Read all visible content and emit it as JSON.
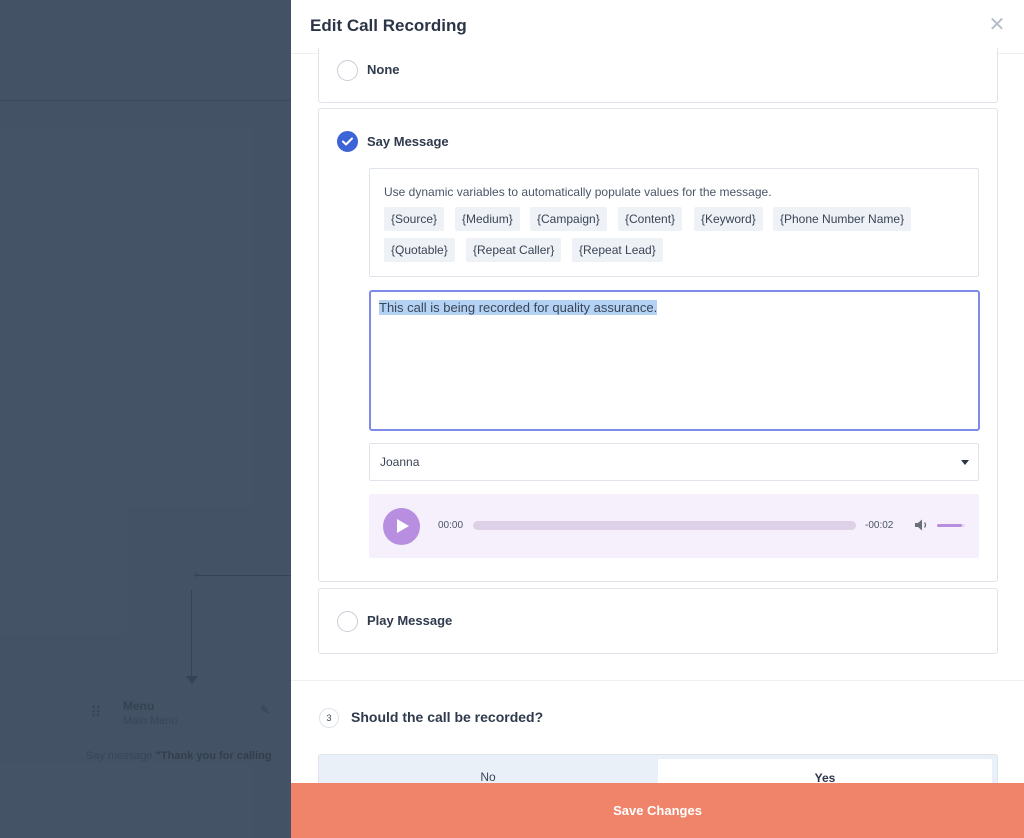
{
  "background": {
    "node_title": "Menu",
    "node_subtitle": "Main Menu",
    "node_say_prefix": "Say message",
    "node_say_text": "\"Thank you for calling"
  },
  "panel": {
    "title": "Edit Call Recording"
  },
  "options": {
    "none_label": "None",
    "say_label": "Say Message",
    "play_label": "Play Message",
    "selected": "Say Message"
  },
  "variables": {
    "hint": "Use dynamic variables to automatically populate values for the message.",
    "chips": [
      "{Source}",
      "{Medium}",
      "{Campaign}",
      "{Content}",
      "{Keyword}",
      "{Phone Number Name}",
      "{Quotable}",
      "{Repeat Caller}",
      "{Repeat Lead}"
    ]
  },
  "message": {
    "text": "This call is being recorded for quality assurance."
  },
  "voice": {
    "selected": "Joanna"
  },
  "player": {
    "current_time": "00:00",
    "remaining_time": "-00:02",
    "progress": 0,
    "volume": 0.9
  },
  "record_question": {
    "step": "3",
    "title": "Should the call be recorded?",
    "no_label": "No",
    "yes_label": "Yes",
    "selected": "Yes"
  },
  "footer": {
    "save_label": "Save Changes"
  },
  "colors": {
    "accent": "#3d64d6",
    "save": "#f0846a",
    "player": "#b88ee0"
  }
}
